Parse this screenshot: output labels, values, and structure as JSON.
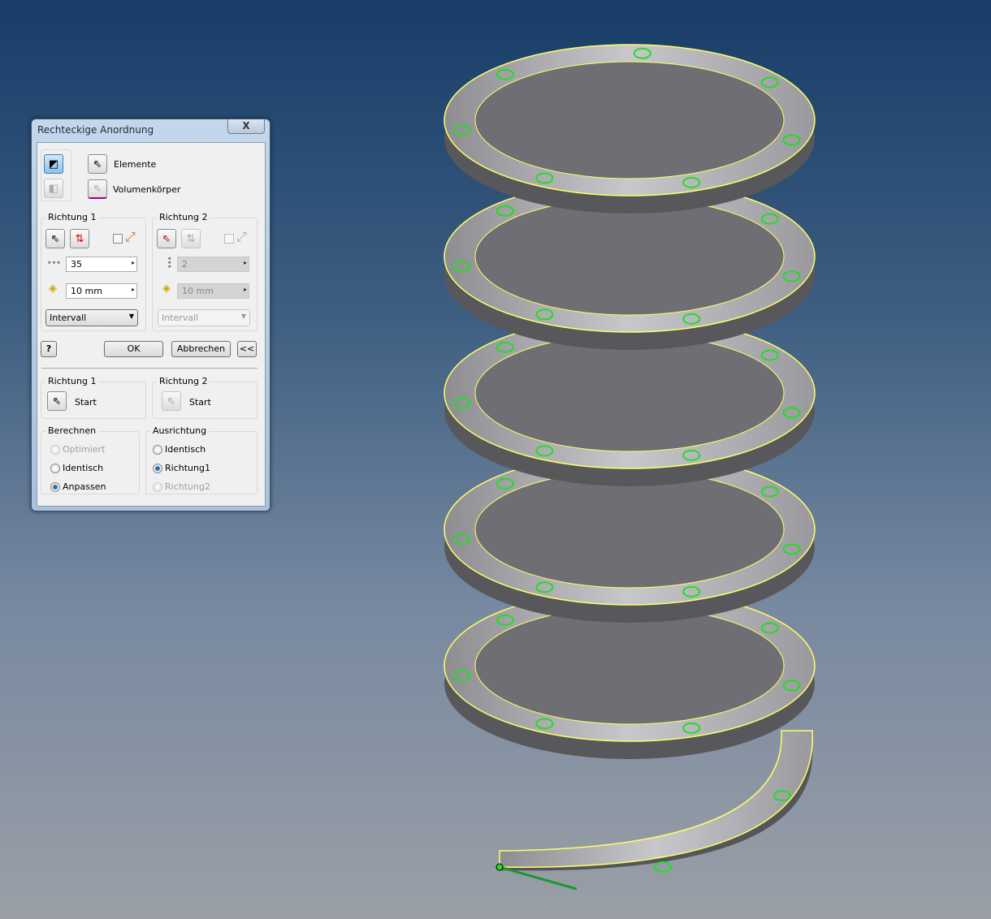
{
  "dialog": {
    "title": "Rechteckige Anordnung",
    "close_label": "X",
    "elemente_label": "Elemente",
    "volumen_label": "Volumenkörper",
    "dir1": {
      "label": "Richtung 1",
      "count": "35",
      "spacing": "10 mm",
      "mode": "Intervall"
    },
    "dir2": {
      "label": "Richtung 2",
      "count": "2",
      "spacing": "10 mm",
      "mode": "Intervall"
    },
    "help_label": "?",
    "ok_label": "OK",
    "cancel_label": "Abbrechen",
    "collapse_label": "<<",
    "start1": {
      "label": "Richtung 1",
      "start": "Start"
    },
    "start2": {
      "label": "Richtung 2",
      "start": "Start"
    },
    "berechnen": {
      "label": "Berechnen",
      "options": [
        "Optimiert",
        "Identisch",
        "Anpassen"
      ],
      "selected": "Anpassen"
    },
    "ausrichtung": {
      "label": "Ausrichtung",
      "options": [
        "Identisch",
        "Richtung1",
        "Richtung2"
      ],
      "selected": "Richtung1"
    }
  },
  "colors": {
    "edge_highlight": "#ffff66",
    "pattern_marker": "#22dd22",
    "spring": "#b8b8bc"
  }
}
